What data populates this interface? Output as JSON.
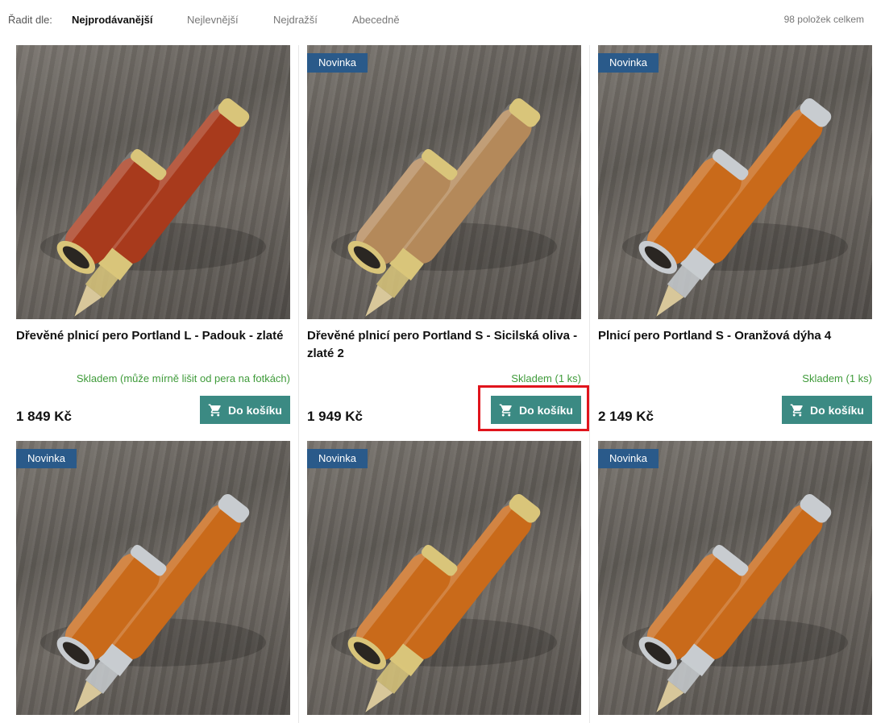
{
  "sort": {
    "label": "Řadit dle:",
    "options": [
      "Nejprodávanější",
      "Nejlevnější",
      "Nejdražší",
      "Abecedně"
    ],
    "active": "Nejprodávanější"
  },
  "total": "98 položek celkem",
  "products": [
    {
      "title": "Dřevěné plnicí pero Portland L - Padouk - zlaté",
      "badge": "",
      "stock": "Skladem (může mírně lišit od pera na fotkách)",
      "price": "1 849 Kč",
      "cart": "Do košíku",
      "wood": "#a83a1c",
      "trim": "#d9c57a"
    },
    {
      "title": "Dřevěné plnicí pero Portland S - Sicilská oliva - zlaté 2",
      "badge": "Novinka",
      "stock": "Skladem (1 ks)",
      "price": "1 949 Kč",
      "cart": "Do košíku",
      "wood": "#b4895a",
      "trim": "#d9c57a"
    },
    {
      "title": "Plnicí pero Portland S - Oranžová dýha 4",
      "badge": "Novinka",
      "stock": "Skladem (1 ks)",
      "price": "2 149 Kč",
      "cart": "Do košíku",
      "wood": "#c96a1a",
      "trim": "#c8ccd0"
    },
    {
      "title": "",
      "badge": "Novinka",
      "stock": "",
      "price": "",
      "cart": "",
      "wood": "#c96a1a",
      "trim": "#c8ccd0"
    },
    {
      "title": "",
      "badge": "Novinka",
      "stock": "",
      "price": "",
      "cart": "",
      "wood": "#c96a1a",
      "trim": "#d9c57a"
    },
    {
      "title": "",
      "badge": "Novinka",
      "stock": "",
      "price": "",
      "cart": "",
      "wood": "#c96a1a",
      "trim": "#c8ccd0"
    }
  ],
  "icons": {
    "cart": "shopping-cart-icon"
  },
  "colors": {
    "accent": "#3b8a83",
    "badge": "#2a5a8a",
    "stock": "#3f9b3a",
    "highlight": "#e0141c"
  }
}
